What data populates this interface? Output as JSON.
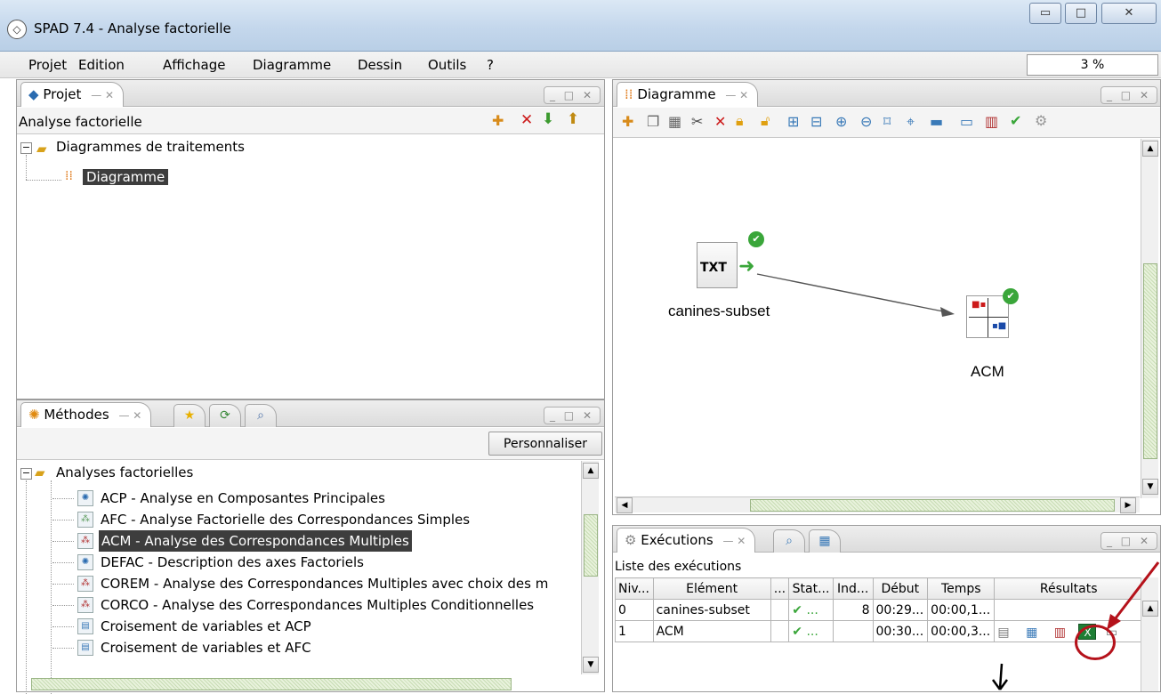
{
  "window": {
    "title": "SPAD 7.4 - Analyse factorielle",
    "controls": {
      "minimize": "▭",
      "maximize": "□",
      "close": "✕"
    }
  },
  "menu": {
    "items": [
      "Projet",
      "Edition",
      "Affichage",
      "Diagramme",
      "Dessin",
      "Outils",
      "?"
    ],
    "progress": "3 %"
  },
  "projet_panel": {
    "tab": "Projet",
    "header": "Analyse factorielle",
    "tree_root": "Diagrammes de traitements",
    "tree_child": "Diagramme"
  },
  "methodes_panel": {
    "tab": "Méthodes",
    "personnaliser": "Personnaliser",
    "group": "Analyses factorielles",
    "items": [
      "ACP - Analyse en Composantes Principales",
      "AFC - Analyse Factorielle des Correspondances Simples",
      "ACM - Analyse des Correspondances Multiples",
      "DEFAC - Description des axes Factoriels",
      "COREM - Analyse des Correspondances Multiples avec choix des m",
      "CORCO - Analyse des Correspondances Multiples Conditionnelles",
      "Croisement de variables et ACP",
      "Croisement de variables et AFC"
    ]
  },
  "diagramme_panel": {
    "tab": "Diagramme",
    "nodes": {
      "source_label": "canines-subset",
      "source_badge": "TXT",
      "target_label": "ACM"
    }
  },
  "executions_panel": {
    "tab": "Exécutions",
    "list_title": "Liste des exécutions",
    "columns": [
      "Niv...",
      "Elément",
      "...",
      "Stat...",
      "Ind...",
      "Début",
      "Temps",
      "Résultats"
    ],
    "rows": [
      {
        "niv": "0",
        "element": "canines-subset",
        "dots": "",
        "stat": "✔ ...",
        "ind": "8",
        "debut": "00:29...",
        "temps": "00:00,1..."
      },
      {
        "niv": "1",
        "element": "ACM",
        "dots": "",
        "stat": "✔ ...",
        "ind": "",
        "debut": "00:30...",
        "temps": "00:00,3..."
      }
    ]
  },
  "colors": {
    "accent_red": "#b5121b",
    "check_green": "#3aa63a",
    "selection": "#3d3d3d"
  }
}
